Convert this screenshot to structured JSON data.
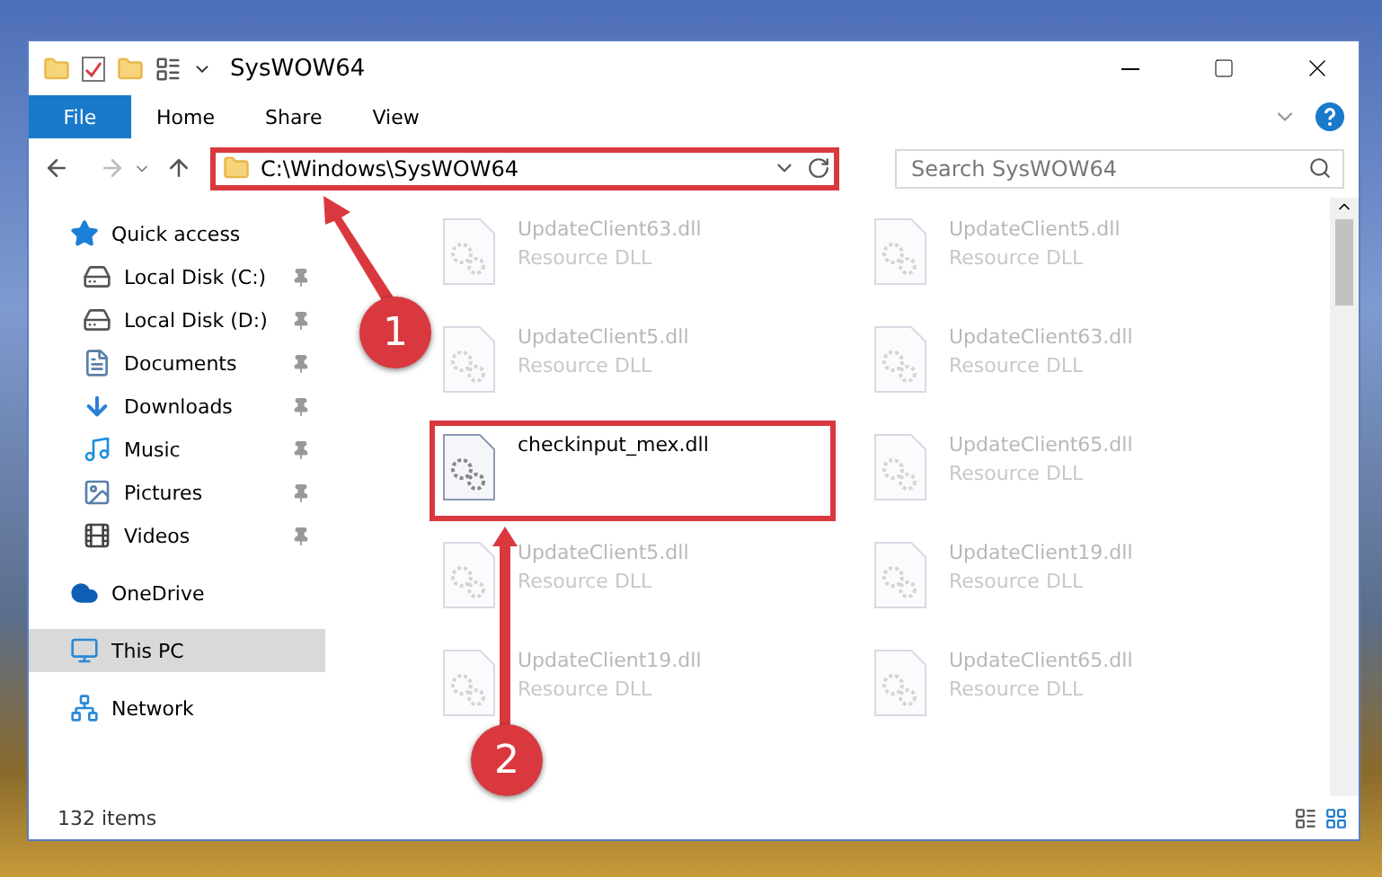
{
  "window": {
    "title": "SysWOW64"
  },
  "ribbon": {
    "tabs": [
      {
        "label": "File",
        "kind": "file",
        "selected": false
      },
      {
        "label": "Home",
        "kind": "tab",
        "selected": false
      },
      {
        "label": "Share",
        "kind": "tab",
        "selected": false
      },
      {
        "label": "View",
        "kind": "tab",
        "selected": false
      }
    ]
  },
  "address": {
    "path": "C:\\Windows\\SysWOW64",
    "highlighted": true
  },
  "search": {
    "placeholder": "Search SysWOW64"
  },
  "sidebar": {
    "items": [
      {
        "label": "Quick access",
        "kind": "star",
        "selected": false,
        "children": [
          {
            "label": "Local Disk (C:)",
            "kind": "drive",
            "pinned": true,
            "selected": false
          },
          {
            "label": "Local Disk (D:)",
            "kind": "drive",
            "pinned": true,
            "selected": false
          },
          {
            "label": "Documents",
            "kind": "documents",
            "pinned": true,
            "selected": false
          },
          {
            "label": "Downloads",
            "kind": "downloads",
            "pinned": true,
            "selected": false
          },
          {
            "label": "Music",
            "kind": "music",
            "pinned": true,
            "selected": false
          },
          {
            "label": "Pictures",
            "kind": "pictures",
            "pinned": true,
            "selected": false
          },
          {
            "label": "Videos",
            "kind": "videos",
            "pinned": true,
            "selected": false
          }
        ]
      },
      {
        "label": "OneDrive",
        "kind": "cloud",
        "selected": false
      },
      {
        "label": "This PC",
        "kind": "pc",
        "selected": true
      },
      {
        "label": "Network",
        "kind": "network",
        "selected": false
      }
    ]
  },
  "files": [
    {
      "name": "UpdateClient63.dll",
      "type": "Resource DLL",
      "faded": true,
      "highlighted": false
    },
    {
      "name": "UpdateClient5.dll",
      "type": "Resource DLL",
      "faded": true,
      "highlighted": false
    },
    {
      "name": "UpdateClient5.dll",
      "type": "Resource DLL",
      "faded": true,
      "highlighted": false
    },
    {
      "name": "UpdateClient63.dll",
      "type": "Resource DLL",
      "faded": true,
      "highlighted": false
    },
    {
      "name": "checkinput_mex.dll",
      "faded": false,
      "highlighted": true
    },
    {
      "name": "UpdateClient65.dll",
      "type": "Resource DLL",
      "faded": true,
      "highlighted": false
    },
    {
      "name": "UpdateClient5.dll",
      "type": "Resource DLL",
      "faded": true,
      "highlighted": false
    },
    {
      "name": "UpdateClient19.dll",
      "type": "Resource DLL",
      "faded": true,
      "highlighted": false
    },
    {
      "name": "UpdateClient19.dll",
      "type": "Resource DLL",
      "faded": true,
      "highlighted": false
    },
    {
      "name": "UpdateClient65.dll",
      "type": "Resource DLL",
      "faded": true,
      "highlighted": false
    }
  ],
  "status_bar": {
    "count": "132 items"
  },
  "annotations": [
    {
      "label": "1"
    },
    {
      "label": "2"
    }
  ]
}
